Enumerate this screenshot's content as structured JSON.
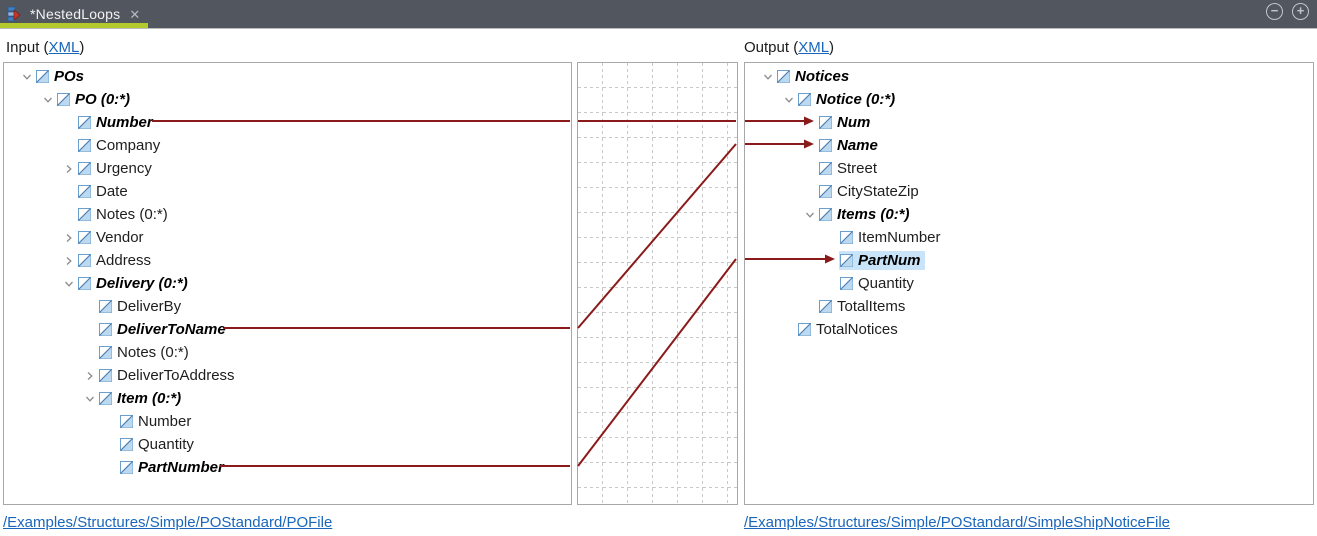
{
  "tab_bar": {
    "tab_label": "*NestedLoops",
    "close_icon": "✕",
    "zoom_out_icon": "−",
    "zoom_in_icon": "+"
  },
  "header": {
    "input_prefix": "Input (",
    "input_link": "XML",
    "input_suffix": ")",
    "output_prefix": "Output (",
    "output_link": "XML",
    "output_suffix": ")"
  },
  "footer": {
    "input_file_link": "/Examples/Structures/Simple/POStandard/POFile",
    "output_file_link": "/Examples/Structures/Simple/POStandard/SimpleShipNoticeFile"
  },
  "input_tree": [
    {
      "label": "POs",
      "level": 0,
      "expand": "open",
      "bold": true
    },
    {
      "label": "PO (0:*)",
      "level": 1,
      "expand": "open",
      "bold": true
    },
    {
      "label": "Number",
      "level": 2,
      "expand": "none",
      "bold": true
    },
    {
      "label": "Company",
      "level": 2,
      "expand": "none",
      "bold": false
    },
    {
      "label": "Urgency",
      "level": 2,
      "expand": "closed",
      "bold": false
    },
    {
      "label": "Date",
      "level": 2,
      "expand": "none",
      "bold": false
    },
    {
      "label": "Notes (0:*)",
      "level": 2,
      "expand": "none",
      "bold": false
    },
    {
      "label": "Vendor",
      "level": 2,
      "expand": "closed",
      "bold": false
    },
    {
      "label": "Address",
      "level": 2,
      "expand": "closed",
      "bold": false
    },
    {
      "label": "Delivery (0:*)",
      "level": 2,
      "expand": "open",
      "bold": true
    },
    {
      "label": "DeliverBy",
      "level": 3,
      "expand": "none",
      "bold": false
    },
    {
      "label": "DeliverToName",
      "level": 3,
      "expand": "none",
      "bold": true
    },
    {
      "label": "Notes (0:*)",
      "level": 3,
      "expand": "none",
      "bold": false
    },
    {
      "label": "DeliverToAddress",
      "level": 3,
      "expand": "closed",
      "bold": false
    },
    {
      "label": "Item (0:*)",
      "level": 3,
      "expand": "open",
      "bold": true
    },
    {
      "label": "Number",
      "level": 4,
      "expand": "none",
      "bold": false
    },
    {
      "label": "Quantity",
      "level": 4,
      "expand": "none",
      "bold": false
    },
    {
      "label": "PartNumber",
      "level": 4,
      "expand": "none",
      "bold": true
    }
  ],
  "output_tree": [
    {
      "label": "Notices",
      "level": 0,
      "expand": "open",
      "bold": true
    },
    {
      "label": "Notice (0:*)",
      "level": 1,
      "expand": "open",
      "bold": true
    },
    {
      "label": "Num",
      "level": 2,
      "expand": "none",
      "bold": true
    },
    {
      "label": "Name",
      "level": 2,
      "expand": "none",
      "bold": true
    },
    {
      "label": "Street",
      "level": 2,
      "expand": "none",
      "bold": false
    },
    {
      "label": "CityStateZip",
      "level": 2,
      "expand": "none",
      "bold": false
    },
    {
      "label": "Items (0:*)",
      "level": 2,
      "expand": "open",
      "bold": true
    },
    {
      "label": "ItemNumber",
      "level": 3,
      "expand": "none",
      "bold": false
    },
    {
      "label": "PartNum",
      "level": 3,
      "expand": "none",
      "bold": true,
      "selected": true
    },
    {
      "label": "Quantity",
      "level": 3,
      "expand": "none",
      "bold": false
    },
    {
      "label": "TotalItems",
      "level": 2,
      "expand": "none",
      "bold": false
    },
    {
      "label": "TotalNotices",
      "level": 1,
      "expand": "none",
      "bold": false
    }
  ],
  "connections": [
    {
      "from": "Number",
      "to": "Num"
    },
    {
      "from": "DeliverToName",
      "to": "Name"
    },
    {
      "from": "PartNumber",
      "to": "PartNum"
    }
  ],
  "colors": {
    "connection": "#8b1a1a",
    "tab_underline": "#b4ca2c",
    "tab_bar_bg": "#52565e",
    "link": "#1a66bb",
    "selection": "#c9e4f8",
    "grid": "#c9c9c9"
  }
}
